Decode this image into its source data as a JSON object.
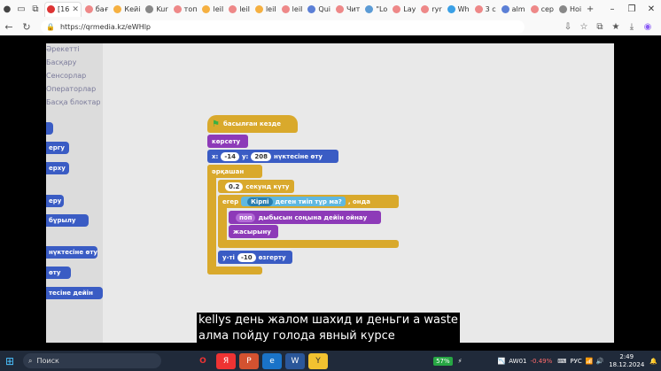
{
  "browser": {
    "tabs": [
      {
        "label": "[16",
        "color": "#d33",
        "active": true
      },
      {
        "label": "бағ",
        "color": "#e88"
      },
      {
        "label": "Кейі",
        "color": "#f5b041"
      },
      {
        "label": "Kur",
        "color": "#888"
      },
      {
        "label": "топ",
        "color": "#e88"
      },
      {
        "label": "leiI",
        "color": "#f5b041"
      },
      {
        "label": "leiI",
        "color": "#e88"
      },
      {
        "label": "leiI",
        "color": "#f5b041"
      },
      {
        "label": "leiI",
        "color": "#e88"
      },
      {
        "label": "Qui",
        "color": "#5b7fd6"
      },
      {
        "label": "Чит",
        "color": "#e88"
      },
      {
        "label": "\"Lo",
        "color": "#5b9bd5"
      },
      {
        "label": "Lay",
        "color": "#e88"
      },
      {
        "label": "ryr",
        "color": "#e88"
      },
      {
        "label": "Wh",
        "color": "#3aa0e6"
      },
      {
        "label": "3 с",
        "color": "#e88"
      },
      {
        "label": "alm",
        "color": "#5b7fd6"
      },
      {
        "label": "сер",
        "color": "#e88"
      },
      {
        "label": "Ноі",
        "color": "#888"
      }
    ],
    "url": "https://qrmedia.kz/eWHlp"
  },
  "palette": {
    "categories": [
      "Әрекетті",
      "Басқару",
      "Сенсорлар",
      "Операторлар",
      "Басқа блоктар"
    ],
    "blocks": [
      "",
      "ергу",
      "ерху",
      "еру",
      "бұрылу",
      "нүктесіне өту",
      "өту",
      "тесіне дейін"
    ]
  },
  "script": {
    "hat": "басылған кезде",
    "show": "көрсету",
    "goto_x_label": "x:",
    "goto_x": "-14",
    "goto_y_label": "y:",
    "goto_y": "208",
    "goto_suffix": "нүктесіне өту",
    "forever": "әрқашан",
    "wait_value": "0.2",
    "wait_suffix": "секунд күту",
    "if_label": "егер",
    "touching_value": "Кірпі",
    "touching_suffix": "деген тиіп тұр ма?",
    "then_label": ", онда",
    "play_sound_value": "поп",
    "play_sound_suffix": "дыбысын соңына дейін ойнау",
    "hide": "жасырыну",
    "change_y_prefix": "у-ті",
    "change_y_value": "-10",
    "change_y_suffix": "өзгерту"
  },
  "caption": {
    "line1": "kellys день жалом шахид и деньги а waste",
    "line2": "алма пойду голода явный курсе"
  },
  "taskbar": {
    "search": "Поиск",
    "battery": "57%",
    "stock_name": "AW01",
    "stock_change": "-0.49%",
    "lang": "РУС",
    "time": "2:49",
    "date": "18.12.2024"
  }
}
